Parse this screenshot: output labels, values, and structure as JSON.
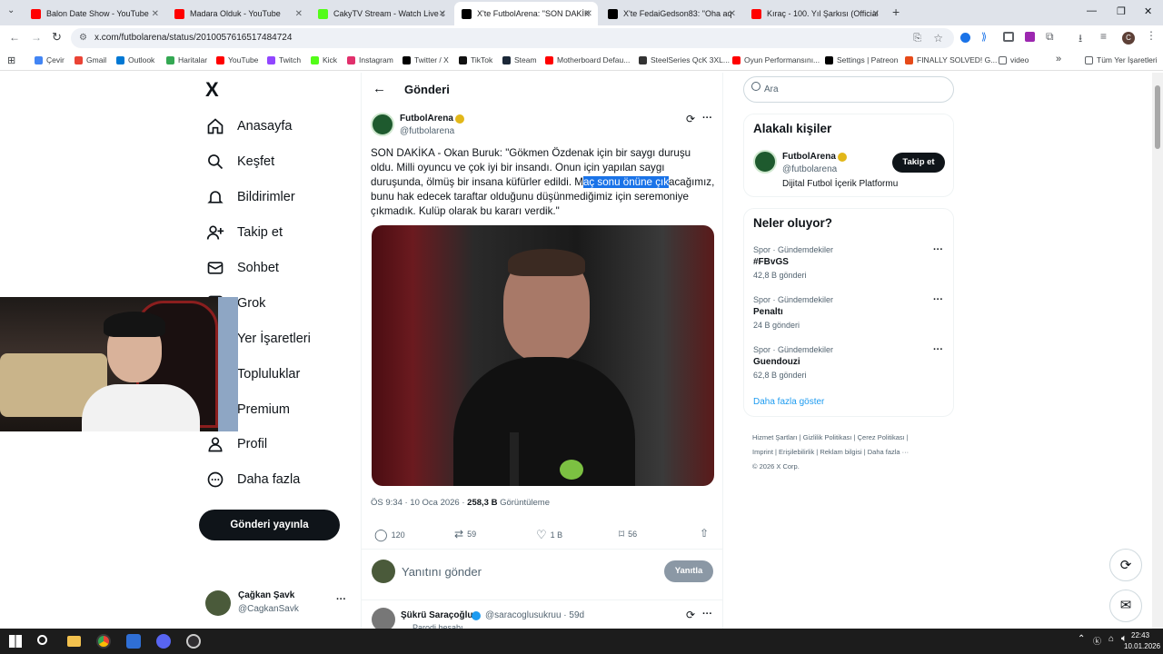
{
  "browser": {
    "tabs": [
      {
        "title": "Balon Date Show - YouTube",
        "color": "#ff0000"
      },
      {
        "title": "Madara Olduk - YouTube",
        "color": "#ff0000"
      },
      {
        "title": "CakyTV Stream - Watch Live on",
        "color": "#53fc18"
      },
      {
        "title": "X'te FutbolArena: \"SON DAKİK",
        "color": "#000000"
      },
      {
        "title": "X'te FedaiGedson83: \"Oha aq T",
        "color": "#000000"
      },
      {
        "title": "Kıraç - 100. Yıl Şarkısı (Official V",
        "color": "#ff0000"
      }
    ],
    "new_tab": "+",
    "url": "x.com/futbolarena/status/2010057616517484724",
    "profile_initial": "C",
    "bookmarks": [
      "Çevir",
      "Gmail",
      "Outlook",
      "Haritalar",
      "YouTube",
      "Twitch",
      "Kick",
      "Instagram",
      "Twitter / X",
      "TikTok",
      "Steam",
      "Motherboard Defau...",
      "SteelSeries QcK 3XL...",
      "Oyun Performansını...",
      "Settings | Patreon",
      "FINALLY SOLVED! G...",
      "video"
    ],
    "more_bookmarks": "»",
    "all_bookmarks": "Tüm Yer İşaretleri"
  },
  "nav": {
    "logo": "X",
    "items": [
      "Anasayfa",
      "Keşfet",
      "Bildirimler",
      "Takip et",
      "Sohbet",
      "Grok",
      "Yer İşaretleri",
      "Topluluklar",
      "Premium",
      "Profil",
      "Daha fazla"
    ],
    "post_button": "Gönderi yayınla",
    "account": {
      "name": "Çağkan Şavk",
      "handle": "@CagkanSavk",
      "more": "···"
    }
  },
  "main": {
    "header": "Gönderi",
    "tweet": {
      "name": "FutbolArena",
      "handle": "@futbolarena",
      "text_before": "SON DAKİKA - Okan Buruk: \"Gökmen Özdenak için bir saygı duruşu oldu. Milli oyuncu ve çok iyi bir insandı. Onun için yapılan saygı duruşunda, ölmüş bir insana küfürler edildi. M",
      "text_highlight": "aç sonu önüne çık",
      "text_after": "acağımız, bunu hak edecek taraftar olduğunu düşünmediğimiz için seremoniye çıkmadık. Kulüp olarak bu kararı verdik.\"",
      "time": "ÖS 9:34 · 10 Oca 2026 · ",
      "views": "258,3 B",
      "views_label": " Görüntüleme",
      "replies": "120",
      "retweets": "59",
      "likes": "1 B",
      "bookmarks": "56",
      "more": "···"
    },
    "reply_placeholder": "Yanıtını gönder",
    "reply_button": "Yanıtla",
    "next_reply": {
      "name": "Şükrü Saraçoğlu",
      "handle": "@saracoglusukruu · 59d",
      "tag": "Parodi hesabı"
    }
  },
  "right": {
    "search_placeholder": "Ara",
    "people_title": "Alakalı kişiler",
    "person": {
      "name": "FutbolArena",
      "handle": "@futbolarena",
      "bio": "Dijital Futbol İçerik Platformu",
      "follow": "Takip et"
    },
    "trends_title": "Neler oluyor?",
    "trends": [
      {
        "context": "Spor · Gündemdekiler",
        "name": "#FBvGS",
        "count": "42,8 B gönderi"
      },
      {
        "context": "Spor · Gündemdekiler",
        "name": "Penaltı",
        "count": "24 B gönderi"
      },
      {
        "context": "Spor · Gündemdekiler",
        "name": "Guendouzi",
        "count": "62,8 B gönderi"
      }
    ],
    "show_more": "Daha fazla göster",
    "footer": [
      "Hizmet Şartları",
      "Gizlilik Politikası",
      "Çerez Politikası",
      "Imprint",
      "Erişilebilirlik",
      "Reklam bilgisi",
      "Daha fazla ···"
    ],
    "copyright": "© 2026 X Corp."
  },
  "taskbar": {
    "time": "22:43",
    "date": "10.01.2026"
  },
  "colors": {
    "accent": "#1d9bf0",
    "verified_gold": "#e2b719",
    "highlight": "#1a73e8"
  }
}
